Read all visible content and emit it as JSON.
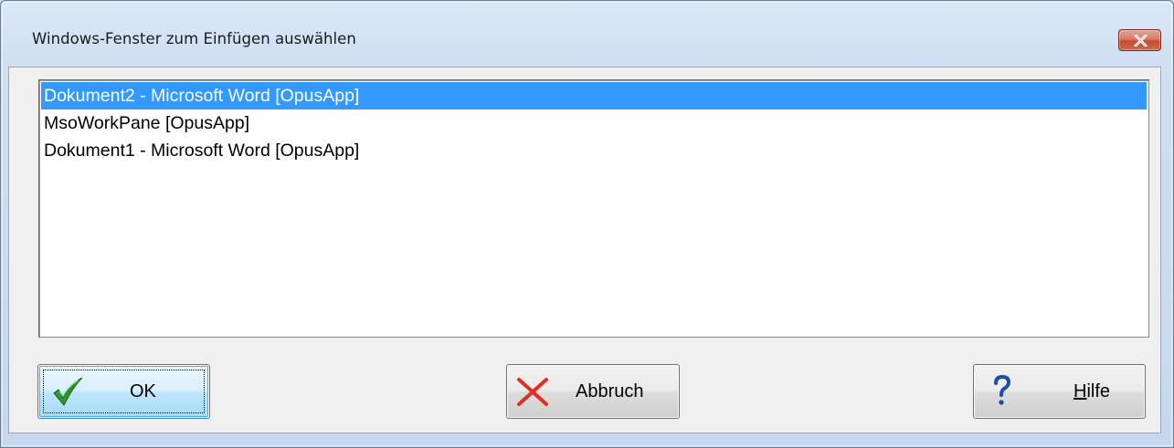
{
  "window": {
    "title": "Windows-Fenster zum Einfügen auswählen"
  },
  "list": {
    "items": [
      {
        "label": "Dokument2 - Microsoft Word [OpusApp]",
        "selected": true
      },
      {
        "label": "MsoWorkPane [OpusApp]",
        "selected": false
      },
      {
        "label": "Dokument1 - Microsoft Word [OpusApp]",
        "selected": false
      }
    ]
  },
  "buttons": {
    "ok_label": "OK",
    "cancel_label": "Abbruch",
    "help_accel": "H",
    "help_rest": "ilfe"
  },
  "icons": {
    "ok": "checkmark-icon",
    "cancel": "cross-icon",
    "help": "question-mark-icon",
    "close": "close-icon"
  },
  "colors": {
    "selection": "#3399ff",
    "close_button": "#c44a2f",
    "ok_check": "#2e9a2e",
    "cancel_cross": "#e03020",
    "help_mark": "#1a4fa8"
  }
}
